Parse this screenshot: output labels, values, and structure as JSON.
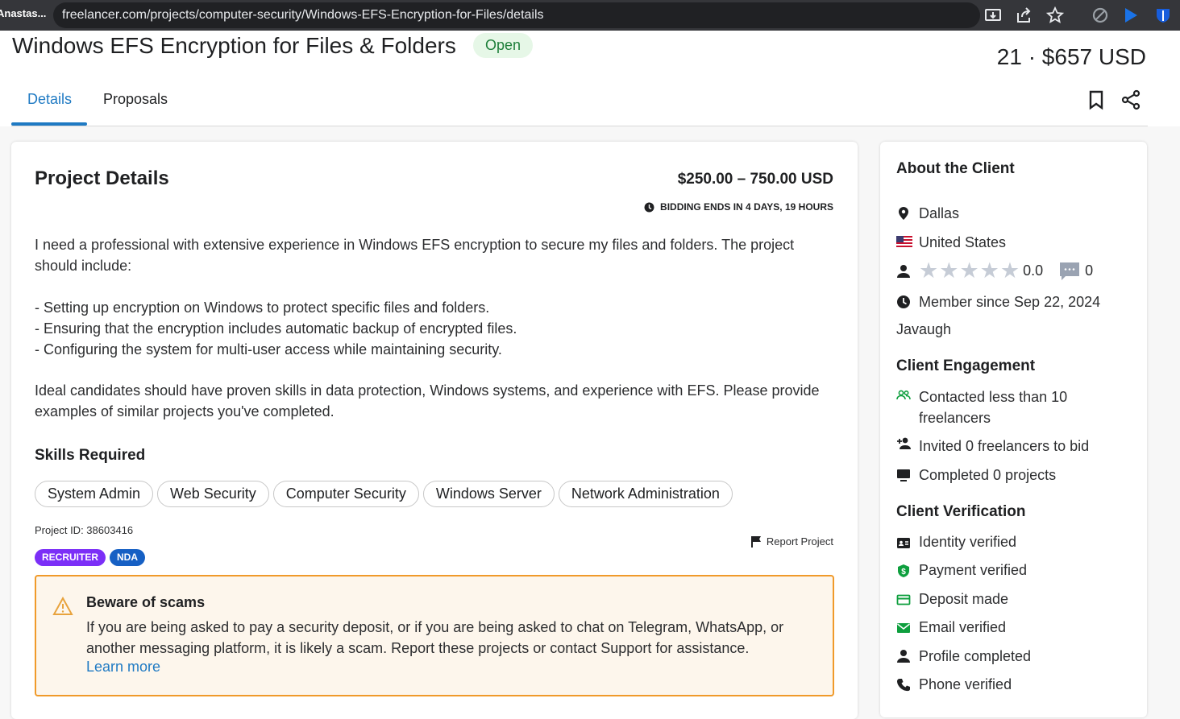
{
  "browser": {
    "tab_title": "Anastas...",
    "url": "freelancer.com/projects/computer-security/Windows-EFS-Encryption-for-Files/details"
  },
  "header": {
    "title": "Windows EFS Encryption for Files & Folders",
    "status": "Open",
    "bids_summary": "21 · $657 USD",
    "tabs": [
      {
        "label": "Details"
      },
      {
        "label": "Proposals"
      }
    ]
  },
  "project": {
    "heading": "Project Details",
    "budget": "$250.00 – 750.00 USD",
    "bidding_ends": "BIDDING ENDS IN 4 DAYS, 19 HOURS",
    "description": [
      "I need a professional with extensive experience in Windows EFS encryption to secure my files and folders. The project should include:",
      "- Setting up encryption on Windows to protect specific files and folders.",
      "- Ensuring that the encryption includes automatic backup of encrypted files.",
      "- Configuring the system for multi-user access while maintaining security.",
      "Ideal candidates should have proven skills in data protection, Windows systems, and experience with EFS. Please provide examples of similar projects you've completed."
    ],
    "skills_heading": "Skills Required",
    "skills": [
      "System Admin",
      "Web Security",
      "Computer Security",
      "Windows Server",
      "Network Administration"
    ],
    "project_id": "Project ID: 38603416",
    "report_label": "Report Project",
    "badges": [
      {
        "label": "RECRUITER",
        "color": "#7b2ff7"
      },
      {
        "label": "NDA",
        "color": "#1660c4"
      }
    ],
    "warning": {
      "title": "Beware of scams",
      "text": "If you are being asked to pay a security deposit, or if you are being asked to chat on Telegram, WhatsApp, or another messaging platform, it is likely a scam. Report these projects or contact Support for assistance.",
      "link": "Learn more"
    }
  },
  "client": {
    "heading": "About the Client",
    "city": "Dallas",
    "country": "United States",
    "rating": "0.0",
    "reviews": "0",
    "member_since": "Member since Sep 22, 2024",
    "username": "Javaugh",
    "engagement_heading": "Client Engagement",
    "engagement": [
      {
        "label": "Contacted less than 10 freelancers"
      },
      {
        "label": "Invited 0 freelancers to bid"
      },
      {
        "label": "Completed 0 projects"
      }
    ],
    "verification_heading": "Client Verification",
    "verification": [
      {
        "label": "Identity verified",
        "icon": "id-card-icon"
      },
      {
        "label": "Payment verified",
        "icon": "shield-dollar-icon"
      },
      {
        "label": "Deposit made",
        "icon": "credit-card-icon"
      },
      {
        "label": "Email verified",
        "icon": "envelope-icon"
      },
      {
        "label": "Profile completed",
        "icon": "person-icon"
      },
      {
        "label": "Phone verified",
        "icon": "phone-icon"
      }
    ]
  },
  "colors": {
    "accent": "#1f7ac3",
    "open_green": "#1e7f3a",
    "warning_border": "#f09a2a",
    "verified_green": "#0e9f3e"
  }
}
